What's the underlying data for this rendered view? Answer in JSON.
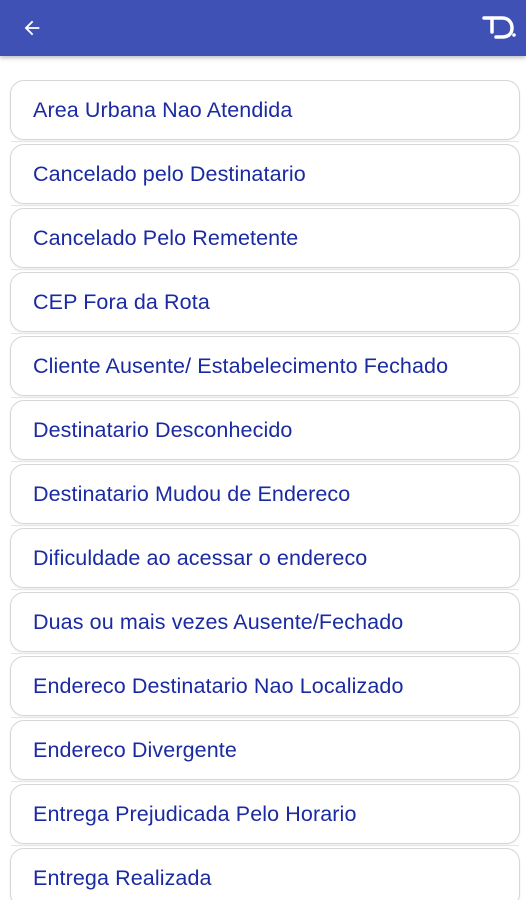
{
  "header": {
    "back_icon": "arrow-left-icon",
    "logo_icon": "app-logo-icon",
    "bar_color": "#3f51b5",
    "text_color": "#1a2aa0"
  },
  "reasons": [
    "Area Urbana Nao Atendida",
    "Cancelado pelo Destinatario",
    "Cancelado Pelo Remetente",
    "CEP Fora da Rota",
    "Cliente Ausente/ Estabelecimento Fechado",
    "Destinatario Desconhecido",
    "Destinatario Mudou de Endereco",
    "Dificuldade ao acessar o endereco",
    "Duas ou mais vezes Ausente/Fechado",
    "Endereco Destinatario Nao Localizado",
    "Endereco Divergente",
    "Entrega Prejudicada Pelo Horario",
    "Entrega Realizada"
  ]
}
